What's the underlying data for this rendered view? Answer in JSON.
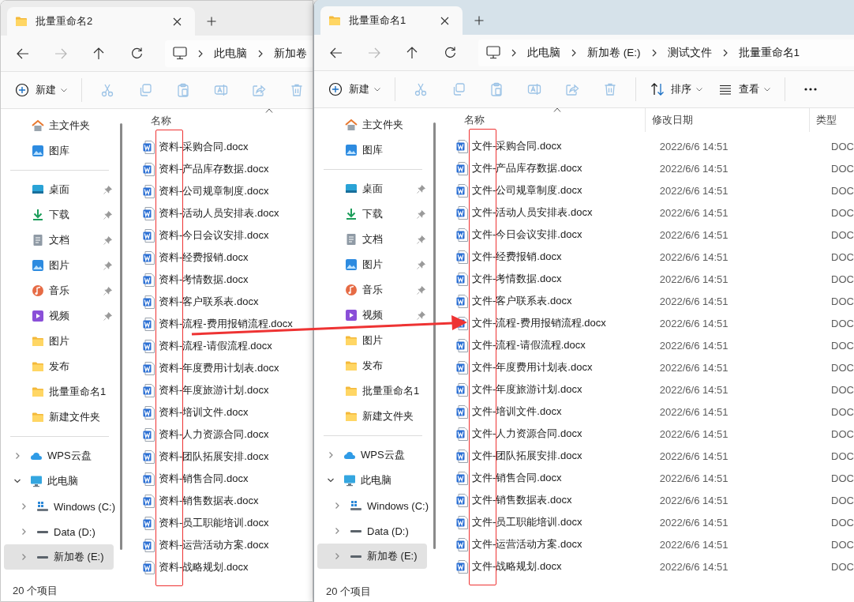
{
  "windows": [
    {
      "active": false,
      "prefix_marked": true,
      "tab": {
        "title": "批量重命名2"
      },
      "breadcrumb": [
        "此电脑",
        "新加卷"
      ],
      "toolbar": [
        {
          "kind": "new",
          "label": "新建",
          "disabled": false
        },
        {
          "kind": "cut",
          "disabled": true
        },
        {
          "kind": "copy",
          "disabled": true
        },
        {
          "kind": "paste",
          "disabled": true
        },
        {
          "kind": "rename",
          "disabled": true
        },
        {
          "kind": "share",
          "disabled": true
        },
        {
          "kind": "delete",
          "disabled": true
        }
      ],
      "sidebar": [
        {
          "items": [
            {
              "kind": "home",
              "label": "主文件夹",
              "pinned": false,
              "selected": false
            },
            {
              "kind": "gallery",
              "label": "图库",
              "pinned": false,
              "selected": false
            }
          ]
        },
        {
          "items": [
            {
              "kind": "desktop",
              "label": "桌面",
              "pinned": true,
              "selected": false
            },
            {
              "kind": "download",
              "label": "下载",
              "pinned": true,
              "selected": false
            },
            {
              "kind": "documents",
              "label": "文档",
              "pinned": true,
              "selected": false
            },
            {
              "kind": "pictures",
              "label": "图片",
              "pinned": true,
              "selected": false
            },
            {
              "kind": "music",
              "label": "音乐",
              "pinned": true,
              "selected": false
            },
            {
              "kind": "videos",
              "label": "视频",
              "pinned": true,
              "selected": false
            },
            {
              "kind": "folder",
              "label": "图片",
              "pinned": false,
              "selected": false
            },
            {
              "kind": "folder",
              "label": "发布",
              "pinned": false,
              "selected": false
            },
            {
              "kind": "folder",
              "label": "批量重命名1",
              "pinned": false,
              "selected": false
            },
            {
              "kind": "folder",
              "label": "新建文件夹",
              "pinned": false,
              "selected": false
            }
          ]
        },
        {
          "items": [
            {
              "kind": "cloud",
              "label": "WPS云盘",
              "expanded": false,
              "selected": false
            },
            {
              "kind": "pc",
              "label": "此电脑",
              "expanded": true,
              "selected": false,
              "children": [
                {
                  "kind": "drive_windows",
                  "label": "Windows (C:)",
                  "expanded": false,
                  "selected": false
                },
                {
                  "kind": "drive",
                  "label": "Data (D:)",
                  "expanded": false,
                  "selected": false
                },
                {
                  "kind": "drive",
                  "label": "新加卷 (E:)",
                  "expanded": false,
                  "selected": true
                }
              ]
            }
          ]
        }
      ],
      "columns": [
        {
          "label": "名称"
        }
      ],
      "files": [
        {
          "name": "资料-采购合同.docx"
        },
        {
          "name": "资料-产品库存数据.docx"
        },
        {
          "name": "资料-公司规章制度.docx"
        },
        {
          "name": "资料-活动人员安排表.docx"
        },
        {
          "name": "资料-今日会议安排.docx"
        },
        {
          "name": "资料-经费报销.docx"
        },
        {
          "name": "资料-考情数据.docx"
        },
        {
          "name": "资料-客户联系表.docx"
        },
        {
          "name": "资料-流程-费用报销流程.docx"
        },
        {
          "name": "资料-流程-请假流程.docx"
        },
        {
          "name": "资料-年度费用计划表.docx"
        },
        {
          "name": "资料-年度旅游计划.docx"
        },
        {
          "name": "资料-培训文件.docx"
        },
        {
          "name": "资料-人力资源合同.docx"
        },
        {
          "name": "资料-团队拓展安排.docx"
        },
        {
          "name": "资料-销售合同.docx"
        },
        {
          "name": "资料-销售数据表.docx"
        },
        {
          "name": "资料-员工职能培训.docx"
        },
        {
          "name": "资料-运营活动方案.docx"
        },
        {
          "name": "资料-战略规划.docx"
        }
      ],
      "status": "20 个项目"
    },
    {
      "active": true,
      "prefix_marked": true,
      "tab": {
        "title": "批量重命名1"
      },
      "breadcrumb": [
        "此电脑",
        "新加卷 (E:)",
        "测试文件",
        "批量重命名1"
      ],
      "toolbar": [
        {
          "kind": "new",
          "label": "新建",
          "disabled": false
        },
        {
          "kind": "cut",
          "disabled": true
        },
        {
          "kind": "copy",
          "disabled": true
        },
        {
          "kind": "paste",
          "disabled": true
        },
        {
          "kind": "rename",
          "disabled": true
        },
        {
          "kind": "share",
          "disabled": true
        },
        {
          "kind": "delete",
          "disabled": true
        },
        {
          "kind": "sort",
          "label": "排序",
          "disabled": false
        },
        {
          "kind": "view",
          "label": "查看",
          "disabled": false
        },
        {
          "kind": "more",
          "disabled": false
        }
      ],
      "sidebar": [
        {
          "items": [
            {
              "kind": "home",
              "label": "主文件夹",
              "pinned": false,
              "selected": false
            },
            {
              "kind": "gallery",
              "label": "图库",
              "pinned": false,
              "selected": false
            }
          ]
        },
        {
          "items": [
            {
              "kind": "desktop",
              "label": "桌面",
              "pinned": true,
              "selected": false
            },
            {
              "kind": "download",
              "label": "下载",
              "pinned": true,
              "selected": false
            },
            {
              "kind": "documents",
              "label": "文档",
              "pinned": true,
              "selected": false
            },
            {
              "kind": "pictures",
              "label": "图片",
              "pinned": true,
              "selected": false
            },
            {
              "kind": "music",
              "label": "音乐",
              "pinned": true,
              "selected": false
            },
            {
              "kind": "videos",
              "label": "视频",
              "pinned": true,
              "selected": false
            },
            {
              "kind": "folder",
              "label": "图片",
              "pinned": false,
              "selected": false
            },
            {
              "kind": "folder",
              "label": "发布",
              "pinned": false,
              "selected": false
            },
            {
              "kind": "folder",
              "label": "批量重命名1",
              "pinned": false,
              "selected": false
            },
            {
              "kind": "folder",
              "label": "新建文件夹",
              "pinned": false,
              "selected": false
            }
          ]
        },
        {
          "items": [
            {
              "kind": "cloud",
              "label": "WPS云盘",
              "expanded": false,
              "selected": false
            },
            {
              "kind": "pc",
              "label": "此电脑",
              "expanded": true,
              "selected": false,
              "children": [
                {
                  "kind": "drive_windows",
                  "label": "Windows (C:)",
                  "expanded": false,
                  "selected": false
                },
                {
                  "kind": "drive",
                  "label": "Data (D:)",
                  "expanded": false,
                  "selected": false
                },
                {
                  "kind": "drive",
                  "label": "新加卷 (E:)",
                  "expanded": false,
                  "selected": true
                }
              ]
            }
          ]
        }
      ],
      "columns": [
        {
          "label": "名称"
        },
        {
          "label": "修改日期"
        },
        {
          "label": "类型"
        }
      ],
      "files": [
        {
          "name": "文件-采购合同.docx",
          "modified": "2022/6/6 14:51",
          "type": "DOC"
        },
        {
          "name": "文件-产品库存数据.docx",
          "modified": "2022/6/6 14:51",
          "type": "DOC"
        },
        {
          "name": "文件-公司规章制度.docx",
          "modified": "2022/6/6 14:51",
          "type": "DOC"
        },
        {
          "name": "文件-活动人员安排表.docx",
          "modified": "2022/6/6 14:51",
          "type": "DOC"
        },
        {
          "name": "文件-今日会议安排.docx",
          "modified": "2022/6/6 14:51",
          "type": "DOC"
        },
        {
          "name": "文件-经费报销.docx",
          "modified": "2022/6/6 14:51",
          "type": "DOC"
        },
        {
          "name": "文件-考情数据.docx",
          "modified": "2022/6/6 14:51",
          "type": "DOC"
        },
        {
          "name": "文件-客户联系表.docx",
          "modified": "2022/6/6 14:51",
          "type": "DOC"
        },
        {
          "name": "文件-流程-费用报销流程.docx",
          "modified": "2022/6/6 14:51",
          "type": "DOC"
        },
        {
          "name": "文件-流程-请假流程.docx",
          "modified": "2022/6/6 14:51",
          "type": "DOC"
        },
        {
          "name": "文件-年度费用计划表.docx",
          "modified": "2022/6/6 14:51",
          "type": "DOC"
        },
        {
          "name": "文件-年度旅游计划.docx",
          "modified": "2022/6/6 14:51",
          "type": "DOC"
        },
        {
          "name": "文件-培训文件.docx",
          "modified": "2022/6/6 14:51",
          "type": "DOC"
        },
        {
          "name": "文件-人力资源合同.docx",
          "modified": "2022/6/6 14:51",
          "type": "DOC"
        },
        {
          "name": "文件-团队拓展安排.docx",
          "modified": "2022/6/6 14:51",
          "type": "DOC"
        },
        {
          "name": "文件-销售合同.docx",
          "modified": "2022/6/6 14:51",
          "type": "DOC"
        },
        {
          "name": "文件-销售数据表.docx",
          "modified": "2022/6/6 14:51",
          "type": "DOC"
        },
        {
          "name": "文件-员工职能培训.docx",
          "modified": "2022/6/6 14:51",
          "type": "DOC"
        },
        {
          "name": "文件-运营活动方案.docx",
          "modified": "2022/6/6 14:51",
          "type": "DOC"
        },
        {
          "name": "文件-战略规划.docx",
          "modified": "2022/6/6 14:51",
          "type": "DOC"
        }
      ],
      "status": "20 个项目"
    }
  ],
  "arrow": true
}
